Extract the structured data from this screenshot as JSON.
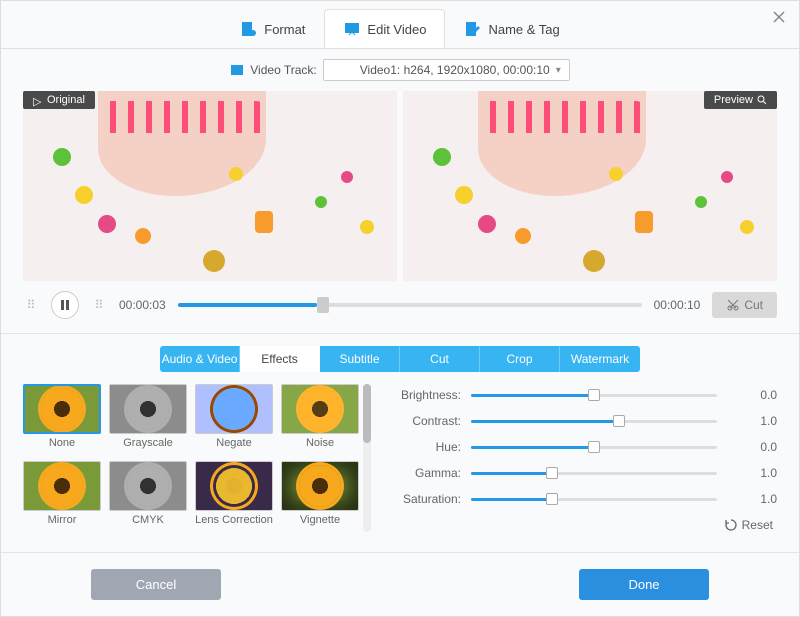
{
  "close_icon": "close",
  "top_tabs": {
    "format": "Format",
    "edit_video": "Edit Video",
    "name_tag": "Name & Tag",
    "active": "edit_video"
  },
  "video_track": {
    "label": "Video Track:",
    "selected": "Video1: h264, 1920x1080, 00:00:10"
  },
  "preview": {
    "original_label": "Original",
    "preview_label": "Preview"
  },
  "playback": {
    "current_time": "00:00:03",
    "total_time": "00:00:10",
    "progress_pct": 30,
    "cut_label": "Cut"
  },
  "sub_tabs": {
    "items": [
      "Audio & Video",
      "Effects",
      "Subtitle",
      "Cut",
      "Crop",
      "Watermark"
    ],
    "active_index": 1
  },
  "effects": [
    {
      "name": "None",
      "style": "none",
      "selected": true
    },
    {
      "name": "Grayscale",
      "style": "gray"
    },
    {
      "name": "Negate",
      "style": "negate"
    },
    {
      "name": "Noise",
      "style": "noise"
    },
    {
      "name": "Mirror",
      "style": "mirror"
    },
    {
      "name": "CMYK",
      "style": "cmyk"
    },
    {
      "name": "Lens Correction",
      "style": "lens"
    },
    {
      "name": "Vignette",
      "style": "vignette"
    }
  ],
  "sliders": {
    "brightness": {
      "label": "Brightness:",
      "value": "0.0",
      "pct": 50
    },
    "contrast": {
      "label": "Contrast:",
      "value": "1.0",
      "pct": 60
    },
    "hue": {
      "label": "Hue:",
      "value": "0.0",
      "pct": 50
    },
    "gamma": {
      "label": "Gamma:",
      "value": "1.0",
      "pct": 33
    },
    "saturation": {
      "label": "Saturation:",
      "value": "1.0",
      "pct": 33
    }
  },
  "reset_label": "Reset",
  "buttons": {
    "cancel": "Cancel",
    "done": "Done"
  }
}
